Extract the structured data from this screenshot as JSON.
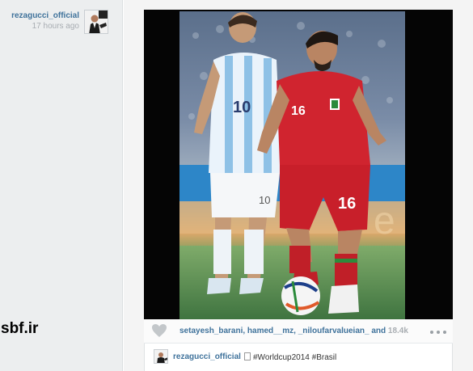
{
  "sidebar": {
    "username": "rezagucci_official",
    "time": "17 hours ago",
    "avatar_icon": "profile-photo-icon",
    "watermark": "sbf.ir"
  },
  "post": {
    "photo_icon": "post-photo",
    "like_icon": "heart-icon",
    "likes": {
      "names": "setayesh_barani, hamed__mz, _niloufarvalueian_ and",
      "count": "18.4k"
    },
    "more_icon": "more-options-icon",
    "caption": {
      "avatar_icon": "profile-photo-icon",
      "username": "rezagucci_official",
      "text": "#Worldcup2014 #Brasil"
    }
  },
  "colors": {
    "link_blue": "#3f729b",
    "muted_gray": "#a8adb2",
    "sidebar_bg": "#eceeef",
    "frame_black": "#050505",
    "red_kit": "#d0242f",
    "argentina_blue": "#8ec1e6"
  }
}
